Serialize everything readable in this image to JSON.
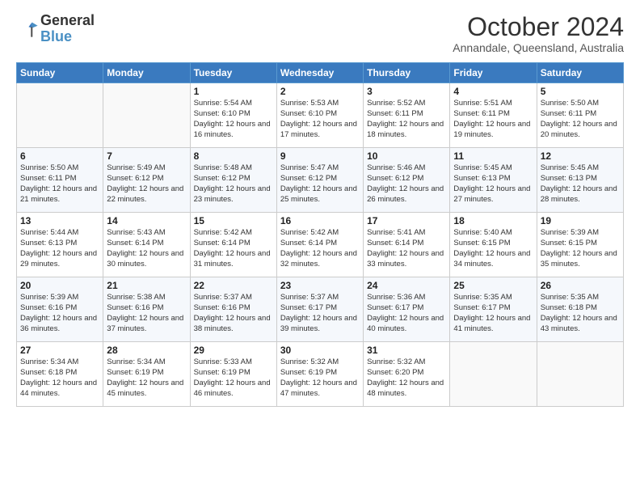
{
  "logo": {
    "line1": "General",
    "line2": "Blue"
  },
  "title": "October 2024",
  "subtitle": "Annandale, Queensland, Australia",
  "weekdays": [
    "Sunday",
    "Monday",
    "Tuesday",
    "Wednesday",
    "Thursday",
    "Friday",
    "Saturday"
  ],
  "weeks": [
    [
      {
        "day": "",
        "info": ""
      },
      {
        "day": "",
        "info": ""
      },
      {
        "day": "1",
        "info": "Sunrise: 5:54 AM\nSunset: 6:10 PM\nDaylight: 12 hours and 16 minutes."
      },
      {
        "day": "2",
        "info": "Sunrise: 5:53 AM\nSunset: 6:10 PM\nDaylight: 12 hours and 17 minutes."
      },
      {
        "day": "3",
        "info": "Sunrise: 5:52 AM\nSunset: 6:11 PM\nDaylight: 12 hours and 18 minutes."
      },
      {
        "day": "4",
        "info": "Sunrise: 5:51 AM\nSunset: 6:11 PM\nDaylight: 12 hours and 19 minutes."
      },
      {
        "day": "5",
        "info": "Sunrise: 5:50 AM\nSunset: 6:11 PM\nDaylight: 12 hours and 20 minutes."
      }
    ],
    [
      {
        "day": "6",
        "info": "Sunrise: 5:50 AM\nSunset: 6:11 PM\nDaylight: 12 hours and 21 minutes."
      },
      {
        "day": "7",
        "info": "Sunrise: 5:49 AM\nSunset: 6:12 PM\nDaylight: 12 hours and 22 minutes."
      },
      {
        "day": "8",
        "info": "Sunrise: 5:48 AM\nSunset: 6:12 PM\nDaylight: 12 hours and 23 minutes."
      },
      {
        "day": "9",
        "info": "Sunrise: 5:47 AM\nSunset: 6:12 PM\nDaylight: 12 hours and 25 minutes."
      },
      {
        "day": "10",
        "info": "Sunrise: 5:46 AM\nSunset: 6:12 PM\nDaylight: 12 hours and 26 minutes."
      },
      {
        "day": "11",
        "info": "Sunrise: 5:45 AM\nSunset: 6:13 PM\nDaylight: 12 hours and 27 minutes."
      },
      {
        "day": "12",
        "info": "Sunrise: 5:45 AM\nSunset: 6:13 PM\nDaylight: 12 hours and 28 minutes."
      }
    ],
    [
      {
        "day": "13",
        "info": "Sunrise: 5:44 AM\nSunset: 6:13 PM\nDaylight: 12 hours and 29 minutes."
      },
      {
        "day": "14",
        "info": "Sunrise: 5:43 AM\nSunset: 6:14 PM\nDaylight: 12 hours and 30 minutes."
      },
      {
        "day": "15",
        "info": "Sunrise: 5:42 AM\nSunset: 6:14 PM\nDaylight: 12 hours and 31 minutes."
      },
      {
        "day": "16",
        "info": "Sunrise: 5:42 AM\nSunset: 6:14 PM\nDaylight: 12 hours and 32 minutes."
      },
      {
        "day": "17",
        "info": "Sunrise: 5:41 AM\nSunset: 6:14 PM\nDaylight: 12 hours and 33 minutes."
      },
      {
        "day": "18",
        "info": "Sunrise: 5:40 AM\nSunset: 6:15 PM\nDaylight: 12 hours and 34 minutes."
      },
      {
        "day": "19",
        "info": "Sunrise: 5:39 AM\nSunset: 6:15 PM\nDaylight: 12 hours and 35 minutes."
      }
    ],
    [
      {
        "day": "20",
        "info": "Sunrise: 5:39 AM\nSunset: 6:16 PM\nDaylight: 12 hours and 36 minutes."
      },
      {
        "day": "21",
        "info": "Sunrise: 5:38 AM\nSunset: 6:16 PM\nDaylight: 12 hours and 37 minutes."
      },
      {
        "day": "22",
        "info": "Sunrise: 5:37 AM\nSunset: 6:16 PM\nDaylight: 12 hours and 38 minutes."
      },
      {
        "day": "23",
        "info": "Sunrise: 5:37 AM\nSunset: 6:17 PM\nDaylight: 12 hours and 39 minutes."
      },
      {
        "day": "24",
        "info": "Sunrise: 5:36 AM\nSunset: 6:17 PM\nDaylight: 12 hours and 40 minutes."
      },
      {
        "day": "25",
        "info": "Sunrise: 5:35 AM\nSunset: 6:17 PM\nDaylight: 12 hours and 41 minutes."
      },
      {
        "day": "26",
        "info": "Sunrise: 5:35 AM\nSunset: 6:18 PM\nDaylight: 12 hours and 43 minutes."
      }
    ],
    [
      {
        "day": "27",
        "info": "Sunrise: 5:34 AM\nSunset: 6:18 PM\nDaylight: 12 hours and 44 minutes."
      },
      {
        "day": "28",
        "info": "Sunrise: 5:34 AM\nSunset: 6:19 PM\nDaylight: 12 hours and 45 minutes."
      },
      {
        "day": "29",
        "info": "Sunrise: 5:33 AM\nSunset: 6:19 PM\nDaylight: 12 hours and 46 minutes."
      },
      {
        "day": "30",
        "info": "Sunrise: 5:32 AM\nSunset: 6:19 PM\nDaylight: 12 hours and 47 minutes."
      },
      {
        "day": "31",
        "info": "Sunrise: 5:32 AM\nSunset: 6:20 PM\nDaylight: 12 hours and 48 minutes."
      },
      {
        "day": "",
        "info": ""
      },
      {
        "day": "",
        "info": ""
      }
    ]
  ]
}
